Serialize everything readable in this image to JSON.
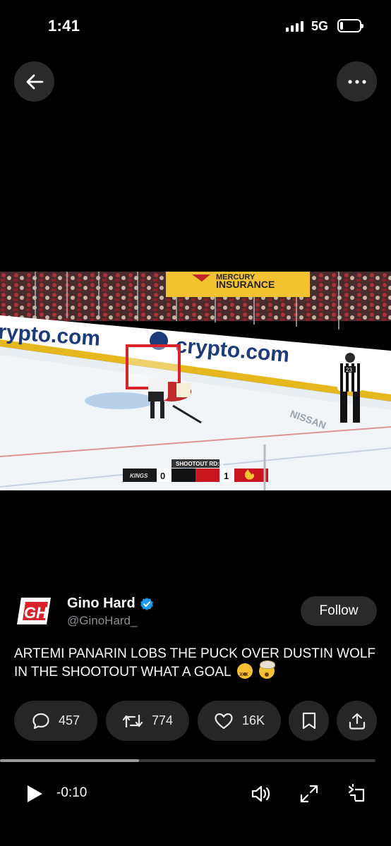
{
  "status_bar": {
    "time": "1:41",
    "network": "5G",
    "battery_level": 0.15
  },
  "top_bar": {
    "back_icon": "arrow-left-icon",
    "more_icon": "ellipsis-icon"
  },
  "video": {
    "scorebug": {
      "label": "SHOOTOUT RD: 2",
      "away_team": "KINGS",
      "away_score": "0",
      "home_score": "1"
    },
    "ads": {
      "board": "crypto.com",
      "banner_top": "MERCURY",
      "banner_bottom": "INSURANCE",
      "ice_text": "NISSAN"
    },
    "referee_number": "23"
  },
  "tweet": {
    "avatar_text": "GH",
    "display_name": "Gino Hard",
    "verified": true,
    "handle": "@GinoHard_",
    "follow_label": "Follow",
    "text": "ARTEMI PANARIN LOBS THE PUCK OVER DUSTIN WOLF IN THE SHOOTOUT WHAT A GOAL",
    "emojis": [
      "dizzy-face-icon",
      "exploding-head-icon"
    ]
  },
  "actions": {
    "replies": "457",
    "reposts": "774",
    "likes": "16K",
    "bookmark_icon": "bookmark-icon",
    "share_icon": "share-icon"
  },
  "player": {
    "progress": 0.37,
    "remaining": "-0:10",
    "play_icon": "play-icon",
    "volume_icon": "speaker-icon",
    "expand_icon": "expand-icon",
    "rotate_icon": "rotate-icon"
  },
  "colors": {
    "background": "#000000",
    "pill": "#262626",
    "verified": "#1d9bf0",
    "brand_red": "#d8232a"
  }
}
